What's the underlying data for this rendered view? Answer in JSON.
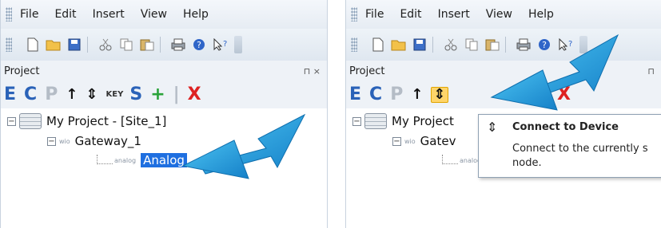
{
  "left_panel": {
    "menu": [
      "File",
      "Edit",
      "Insert",
      "View",
      "Help"
    ],
    "project_header": "Project",
    "pin_glyph": "⊓  ×",
    "project_toolbar": [
      "E",
      "C",
      "P",
      "↑",
      "⇕",
      "KEY",
      "S",
      "+",
      "|",
      "X"
    ],
    "tree": {
      "root_label": "My Project - [Site_1]",
      "gateway_tag": "wio",
      "gateway_label": "Gateway_1",
      "analog_tag": "analog",
      "analog_label": "Analog"
    }
  },
  "right_panel": {
    "menu": [
      "File",
      "Edit",
      "Insert",
      "View",
      "Help"
    ],
    "project_header": "Project",
    "pin_glyph": "⊓",
    "project_toolbar": [
      "E",
      "C",
      "P",
      "↑",
      "⇕",
      "+",
      "|",
      "X"
    ],
    "tree": {
      "root_label": "My Project",
      "gateway_tag": "wio",
      "gateway_label": "Gatev",
      "analog_tag": "analog"
    },
    "tooltip": {
      "title": "Connect to Device",
      "description": "Connect to the currently s node."
    }
  },
  "colors": {
    "accent_blue": "#2a62b8",
    "selection": "#1f6fe0",
    "delete_red": "#d22222",
    "arrow_blue": "#1e9fe0"
  }
}
